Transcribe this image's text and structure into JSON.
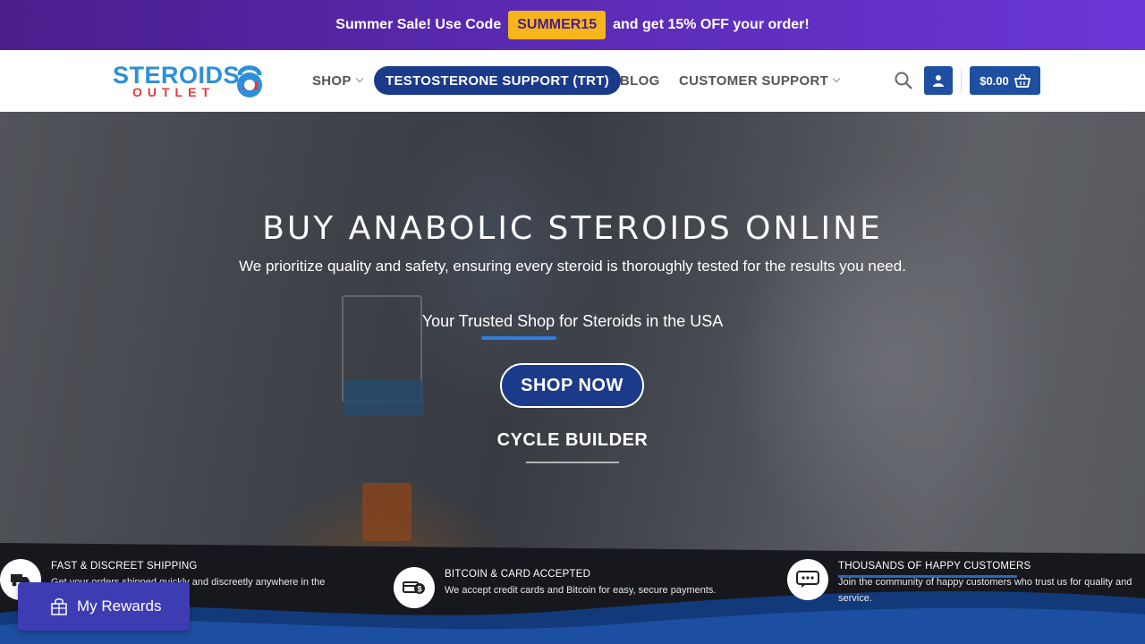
{
  "promo": {
    "text_before": "Summer Sale! Use Code",
    "code": "SUMMER15",
    "text_after": "and get 15% OFF your order!"
  },
  "header": {
    "logo_top": "STEROIDS",
    "logo_bottom": "OUTLET",
    "nav": {
      "shop": "SHOP",
      "trt": "TESTOSTERONE SUPPORT (TRT)",
      "blog": "BLOG",
      "support": "CUSTOMER SUPPORT"
    },
    "cart_total": "$0.00"
  },
  "hero": {
    "title": "BUY ANABOLIC STEROIDS ONLINE",
    "subtitle": "We prioritize quality and safety, ensuring every steroid is thoroughly tested for the results you need.",
    "tagline": "Your Trusted Shop for Steroids in the USA",
    "shop_now": "SHOP NOW",
    "cycle_builder": "CYCLE BUILDER"
  },
  "features": [
    {
      "title": "FAST & DISCREET SHIPPING",
      "desc": "Get your orders shipped quickly and discreetly anywhere in the",
      "icon": "truck-icon"
    },
    {
      "title": "BITCOIN & CARD ACCEPTED",
      "desc": "We accept credit cards and Bitcoin for easy, secure payments.",
      "icon": "payment-icon"
    },
    {
      "title": "THOUSANDS OF HAPPY CUSTOMERS",
      "desc": "Join the community of happy customers who trust us for quality and service.",
      "icon": "chat-icon"
    }
  ],
  "rewards": {
    "label": "My Rewards"
  },
  "colors": {
    "promo_start": "#4a1e8c",
    "promo_end": "#6a36d6",
    "code_bg": "#f7b51c",
    "brand_blue": "#1b3a8a",
    "button_blue": "#1e4fa0",
    "rewards_bg": "#3e3cb3"
  }
}
